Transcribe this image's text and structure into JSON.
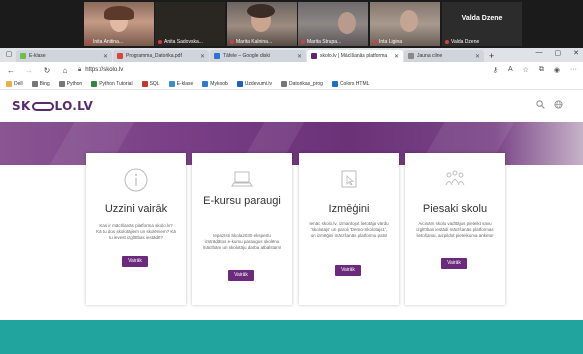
{
  "call": {
    "tiles": [
      {
        "name": "Inita Anitina..."
      },
      {
        "name": "Anita Sadovska..."
      },
      {
        "name": "Marita Kalnina..."
      },
      {
        "name": "Marita Strupa..."
      },
      {
        "name": "Inta Ligina"
      },
      {
        "name": "Valda Dzene"
      }
    ],
    "featured_name": "Valda Dzene"
  },
  "browser": {
    "tabs": [
      {
        "label": "E-klase",
        "active": false,
        "color": "#6cbf4a"
      },
      {
        "label": "Programma_Datorika.pdf",
        "active": false,
        "color": "#d9453d"
      },
      {
        "label": "Tāfele – Google diski",
        "active": false,
        "color": "#2f6fe0"
      },
      {
        "label": "skolo.lv | Mācīšanās platforma",
        "active": true,
        "color": "#5b2a6e"
      },
      {
        "label": "Jauna cilne",
        "active": false,
        "color": "#888888"
      }
    ],
    "url": "https://skolo.lv",
    "bookmarks": [
      {
        "label": "Dell",
        "color": "#e8b04a"
      },
      {
        "label": "Bing",
        "color": "#777777"
      },
      {
        "label": "Python",
        "color": "#777777"
      },
      {
        "label": "Python Tutorial",
        "color": "#2d8a3e"
      },
      {
        "label": "SQL",
        "color": "#c0392b"
      },
      {
        "label": "E-klase",
        "color": "#3b8ed0"
      },
      {
        "label": "Mykoob",
        "color": "#2a7bd5"
      },
      {
        "label": "Uzdevumi.lv",
        "color": "#1f5fbf"
      },
      {
        "label": "Datorikas_prog",
        "color": "#777777"
      },
      {
        "label": "Colors HTML",
        "color": "#1f6fc0"
      }
    ]
  },
  "site": {
    "logo_left": "SK",
    "logo_right": "LO.LV",
    "cards": [
      {
        "title": "Uzzini vairāk",
        "text": "Kas ir mācīšanās platforma skolo.lv? Kā tu dos skolotājiem un skolēniem? Kā tu ievest izglītības iestādē?",
        "button": "Vairāk"
      },
      {
        "title": "E-kursu paraugi",
        "text": "Iepazīsti Skola2030 ekspertu izstrādātos e-kursu paraugus skolēnu mācībām un skolotāju darba atbalstam!",
        "button": "Vairāk"
      },
      {
        "title": "Izmēģini",
        "text": "Ienāc skolo.lv, izmantojot lietotāja vārdu 'skolotajs' un paroli 'Demo-Skolotajs1', un izmēģini mācīšanās platformu pats!",
        "button": "Vairāk"
      },
      {
        "title": "Piesaki skolu",
        "text": "Aicinām skolu vadītājus pieteikt savu izglītības iestādi mācīšanās platformas lietošanai, aizpildot pieteikuma anketu!",
        "button": "Vairāk"
      }
    ]
  }
}
